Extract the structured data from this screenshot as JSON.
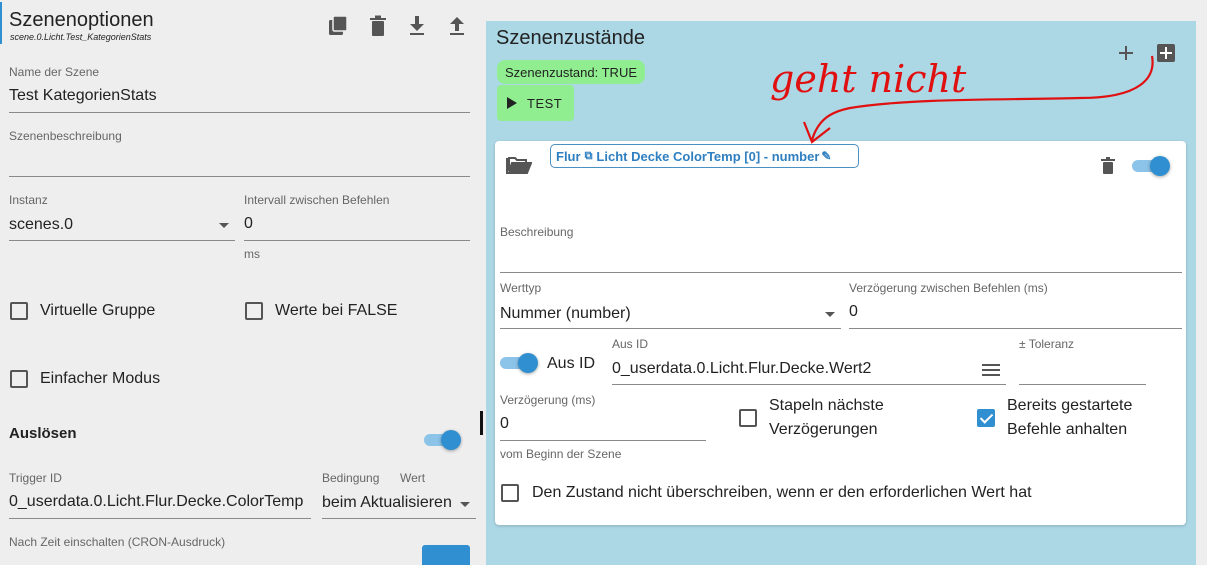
{
  "left": {
    "title": "Szenenoptionen",
    "scene_id": "scene.0.Licht.Test_KategorienStats",
    "name_label": "Name der Szene",
    "name_value": "Test KategorienStats",
    "desc_label": "Szenenbeschreibung",
    "desc_value": "",
    "instance_label": "Instanz",
    "instance_value": "scenes.0",
    "interval_label": "Intervall zwischen Befehlen",
    "interval_value": "0",
    "interval_unit": "ms",
    "virtual_group_label": "Virtuelle Gruppe",
    "values_false_label": "Werte bei FALSE",
    "simple_mode_label": "Einfacher Modus",
    "trigger_heading": "Auslösen",
    "trigger_id_label": "Trigger ID",
    "trigger_id_value": "0_userdata.0.Licht.Flur.Decke.ColorTemp",
    "condition_label": "Bedingung",
    "condition_value": "beim Aktualisieren",
    "wert_label": "Wert",
    "cron_label": "Nach Zeit einschalten (CRON-Ausdruck)"
  },
  "right": {
    "title": "Szenenzustände",
    "state_badge": "Szenenzustand: TRUE",
    "test_button": "TEST",
    "handwritten_note": "geht nicht",
    "card": {
      "chip_text_a": "Flur",
      "chip_text_b": "Licht Decke ColorTemp [0] - number",
      "description_label": "Beschreibung",
      "value_type_label": "Werttyp",
      "value_type_value": "Nummer (number)",
      "delay_between_label": "Verzögerung zwischen Befehlen (ms)",
      "delay_between_value": "0",
      "aus_id_toggle_label": "Aus ID",
      "aus_id_label": "Aus ID",
      "aus_id_value": "0_userdata.0.Licht.Flur.Decke.Wert2",
      "tolerance_label": "± Toleranz",
      "delay_label": "Verzögerung (ms)",
      "delay_value": "0",
      "delay_helper": "vom Beginn der Szene",
      "stack_label_1": "Stapeln nächste",
      "stack_label_2": "Verzögerungen",
      "stop_label_1": "Bereits gestartete",
      "stop_label_2": "Befehle anhalten",
      "no_overwrite_label": "Den Zustand nicht überschreiben, wenn er den erforderlichen Wert hat"
    }
  },
  "colors": {
    "accent": "#2f8fd0",
    "right_panel_bg": "#acd8e6",
    "green_badge": "#90ee90",
    "chip_border": "#4a90c2",
    "annotation": "#e01010"
  }
}
